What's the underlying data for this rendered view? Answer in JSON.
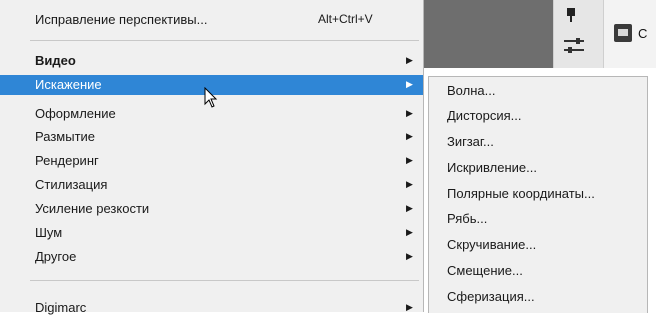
{
  "menu": {
    "top_item": {
      "label": "Исправление перспективы...",
      "shortcut": "Alt+Ctrl+V"
    },
    "items": [
      {
        "label": "Видео",
        "has_submenu": true
      },
      {
        "label": "Искажение",
        "has_submenu": true,
        "highlighted": true
      },
      {
        "label": "Оформление",
        "has_submenu": true
      },
      {
        "label": "Размытие",
        "has_submenu": true
      },
      {
        "label": "Рендеринг",
        "has_submenu": true
      },
      {
        "label": "Стилизация",
        "has_submenu": true
      },
      {
        "label": "Усиление резкости",
        "has_submenu": true
      },
      {
        "label": "Шум",
        "has_submenu": true
      },
      {
        "label": "Другое",
        "has_submenu": true
      }
    ],
    "bottom_item": {
      "label": "Digimarc",
      "has_submenu": true
    }
  },
  "submenu": {
    "items": [
      "Волна...",
      "Дисторсия...",
      "Зигзаг...",
      "Искривление...",
      "Полярные координаты...",
      "Рябь...",
      "Скручивание...",
      "Смещение...",
      "Сферизация..."
    ]
  },
  "background": {
    "panel_label": "С"
  },
  "colors": {
    "highlight": "#2f86d6",
    "menu_bg": "#f0f0f0"
  }
}
